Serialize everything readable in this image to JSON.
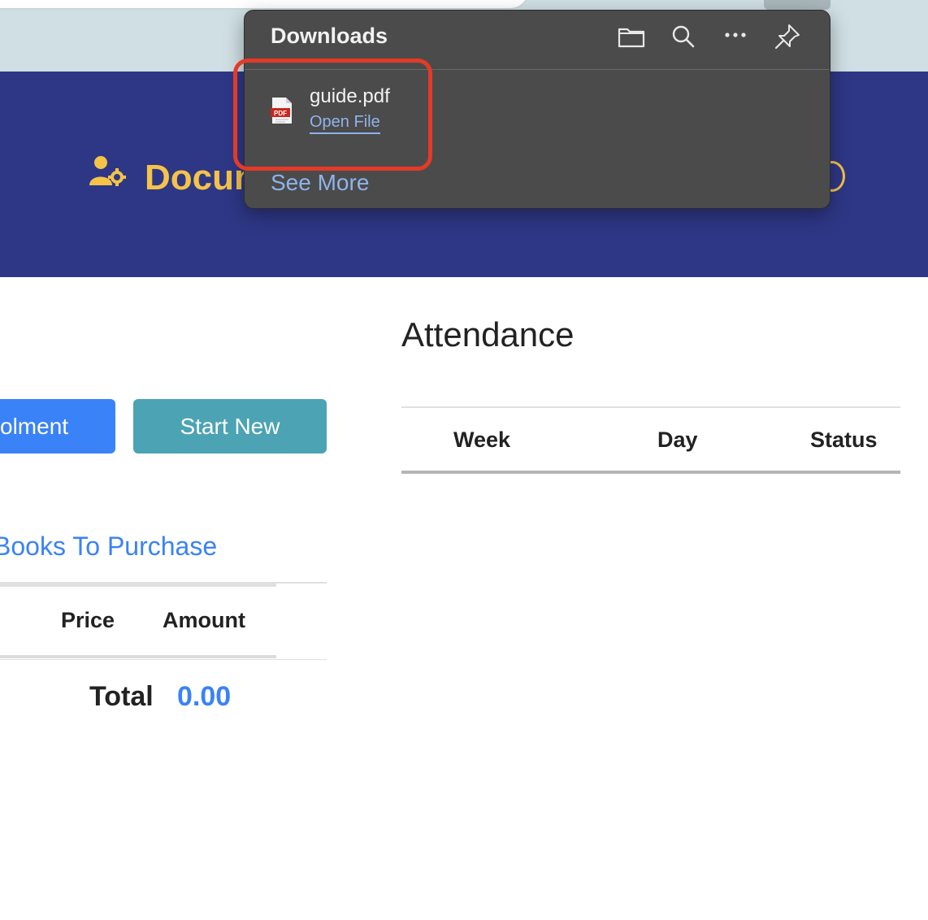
{
  "header": {
    "title": "Docum",
    "subtitle": "",
    "accent_color": "#f4c348",
    "banner_color": "#2e3786",
    "icon": "user-gear-icon"
  },
  "actions": {
    "enrollment_label": "olment",
    "start_new_label": "Start New"
  },
  "books": {
    "link_label": "Books To Purchase",
    "columns": [
      "Price",
      "Amount"
    ],
    "total_label": "Total",
    "total_value": "0.00"
  },
  "attendance": {
    "title": "Attendance",
    "columns": [
      "Week",
      "Day",
      "Status"
    ]
  },
  "downloads": {
    "title": "Downloads",
    "toolbar_icons": [
      "folder-icon",
      "search-icon",
      "more-icon",
      "pin-icon"
    ],
    "items": [
      {
        "file_name": "guide.pdf",
        "action_label": "Open File",
        "icon": "pdf-file-icon",
        "icon_label": "PDF"
      }
    ],
    "see_more_label": "See More"
  }
}
